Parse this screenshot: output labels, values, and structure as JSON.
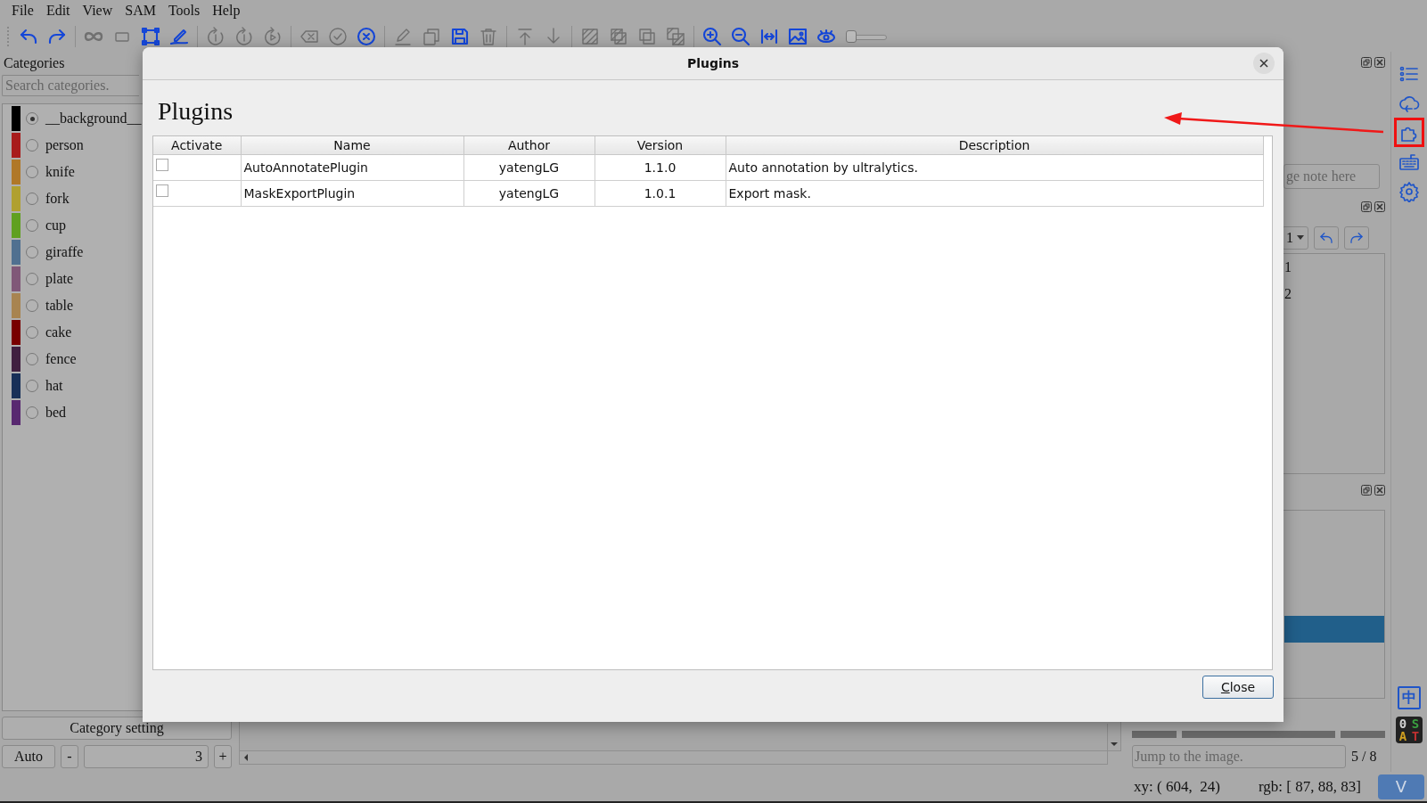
{
  "menu": [
    "File",
    "Edit",
    "View",
    "SAM",
    "Tools",
    "Help"
  ],
  "toolbar": [
    {
      "kind": "undo",
      "disabled": false
    },
    {
      "kind": "redo",
      "disabled": false
    },
    {
      "kind": "sep"
    },
    {
      "kind": "infinity",
      "disabled": true
    },
    {
      "kind": "rect",
      "disabled": true
    },
    {
      "kind": "polygon",
      "disabled": false
    },
    {
      "kind": "pen",
      "disabled": false
    },
    {
      "kind": "sep"
    },
    {
      "kind": "rotate",
      "disabled": true
    },
    {
      "kind": "rotate",
      "disabled": true
    },
    {
      "kind": "play",
      "disabled": true
    },
    {
      "kind": "sep"
    },
    {
      "kind": "backspace",
      "disabled": true
    },
    {
      "kind": "check",
      "disabled": true
    },
    {
      "kind": "xcircle",
      "disabled": false
    },
    {
      "kind": "sep"
    },
    {
      "kind": "pencil",
      "disabled": true
    },
    {
      "kind": "copy",
      "disabled": true
    },
    {
      "kind": "save",
      "disabled": false
    },
    {
      "kind": "trash",
      "disabled": true
    },
    {
      "kind": "sep"
    },
    {
      "kind": "top",
      "disabled": true
    },
    {
      "kind": "down",
      "disabled": true
    },
    {
      "kind": "sep"
    },
    {
      "kind": "hatch",
      "disabled": true
    },
    {
      "kind": "hatch2",
      "disabled": true
    },
    {
      "kind": "overlap",
      "disabled": true
    },
    {
      "kind": "hatch3",
      "disabled": true
    },
    {
      "kind": "sep"
    },
    {
      "kind": "zoomin",
      "disabled": false
    },
    {
      "kind": "zoomout",
      "disabled": false
    },
    {
      "kind": "fitwidth",
      "disabled": false
    },
    {
      "kind": "image",
      "disabled": false
    },
    {
      "kind": "eye",
      "disabled": false
    }
  ],
  "toolbar_slider": {
    "level": 0
  },
  "categories": {
    "title": "Categories",
    "search": {
      "placeholder": "Search categories."
    },
    "items": [
      {
        "label": "__background__",
        "color": "#000000",
        "selected": true
      },
      {
        "label": "person",
        "color": "#a81c1c",
        "selected": false
      },
      {
        "label": "knife",
        "color": "#b07828",
        "selected": false
      },
      {
        "label": "fork",
        "color": "#b0a030",
        "selected": false
      },
      {
        "label": "cup",
        "color": "#60a020",
        "selected": false
      },
      {
        "label": "giraffe",
        "color": "#507090",
        "selected": false
      },
      {
        "label": "plate",
        "color": "#805878",
        "selected": false
      },
      {
        "label": "table",
        "color": "#a88450",
        "selected": false
      },
      {
        "label": "cake",
        "color": "#780000",
        "selected": false
      },
      {
        "label": "fence",
        "color": "#402040",
        "selected": false
      },
      {
        "label": "hat",
        "color": "#183058",
        "selected": false
      },
      {
        "label": "bed",
        "color": "#582870",
        "selected": false
      }
    ],
    "setting_button": "Category setting",
    "auto_button": "Auto",
    "minus_button": "-",
    "width_value": "3",
    "plus_button": "+"
  },
  "right_dock": {
    "note": {
      "placeholder": "ge note here"
    },
    "group_select": "1",
    "group_items": [
      "1",
      "2"
    ],
    "jump": {
      "placeholder": "Jump to the image."
    },
    "page": "5 / 8"
  },
  "side_icons": [
    {
      "kind": "list",
      "highlighted": false
    },
    {
      "kind": "cloud",
      "highlighted": false
    },
    {
      "kind": "plugin",
      "highlighted": true
    },
    {
      "kind": "keyboard",
      "highlighted": false
    },
    {
      "kind": "settings",
      "highlighted": false
    }
  ],
  "lang_button": "中",
  "app_badge": [
    "0",
    "S",
    "A",
    "T"
  ],
  "status": {
    "xy": "xy: ( 604,  24)",
    "rgb": "rgb: [ 87, 88, 83]",
    "mode_button": "V"
  },
  "dialog": {
    "title": "Plugins",
    "heading": "Plugins",
    "columns": [
      "Activate",
      "Name",
      "Author",
      "Version",
      "Description"
    ],
    "rows": [
      {
        "activate": false,
        "name": "AutoAnnotatePlugin",
        "author": "yatengLG",
        "version": "1.1.0",
        "description": "Auto annotation by ultralytics."
      },
      {
        "activate": false,
        "name": "MaskExportPlugin",
        "author": "yatengLG",
        "version": "1.0.1",
        "description": "Export mask."
      }
    ],
    "close_button": "Close"
  }
}
